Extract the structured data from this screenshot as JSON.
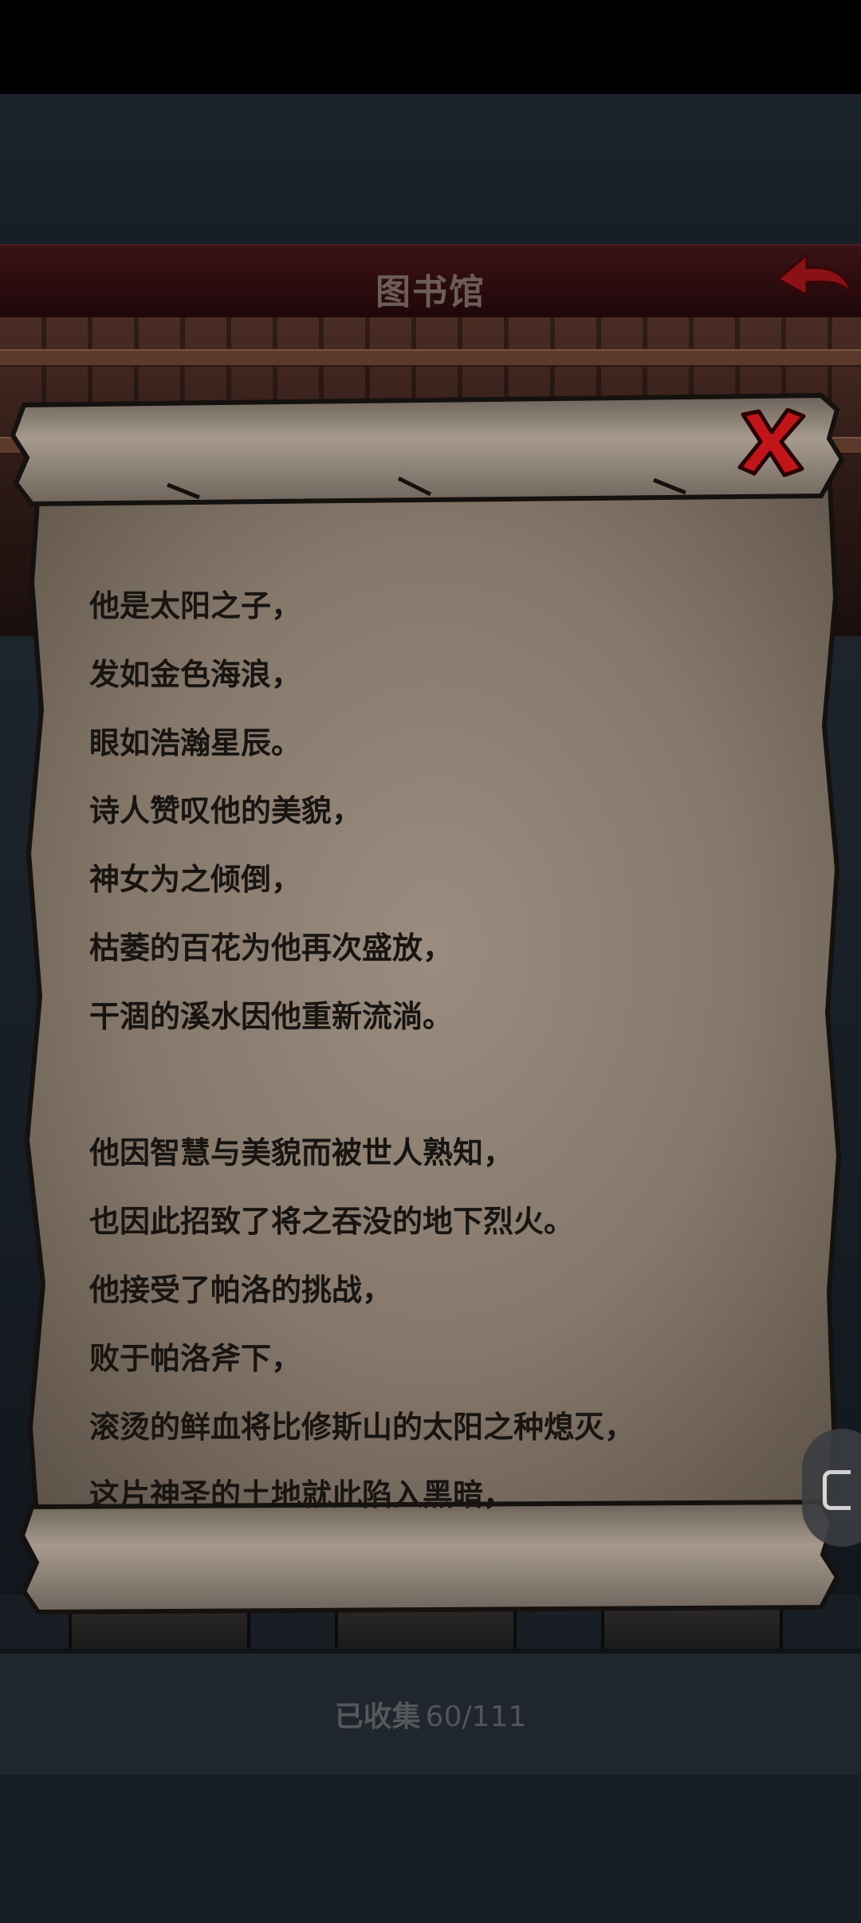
{
  "header": {
    "title": "图书馆",
    "back_icon": "back-arrow-icon"
  },
  "scroll": {
    "close_icon": "close-x-icon",
    "lines": [
      "他是太阳之子，",
      "发如金色海浪，",
      "眼如浩瀚星辰。",
      "诗人赞叹他的美貌，",
      "神女为之倾倒，",
      "枯萎的百花为他再次盛放，",
      "干涸的溪水因他重新流淌。",
      "",
      "他因智慧与美貌而被世人熟知，",
      "也因此招致了将之吞没的地下烈火。",
      "他接受了帕洛的挑战，",
      "败于帕洛斧下，",
      "滚烫的鲜血将比修斯山的太阳之种熄灭，",
      "这片神圣的土地就此陷入黑暗，"
    ]
  },
  "footer": {
    "collected_label": "已收集",
    "collected_count": "60/111"
  },
  "colors": {
    "header_red": "#2a0b0e",
    "parchment": "#8f8174",
    "close_red": "#c0161b"
  }
}
